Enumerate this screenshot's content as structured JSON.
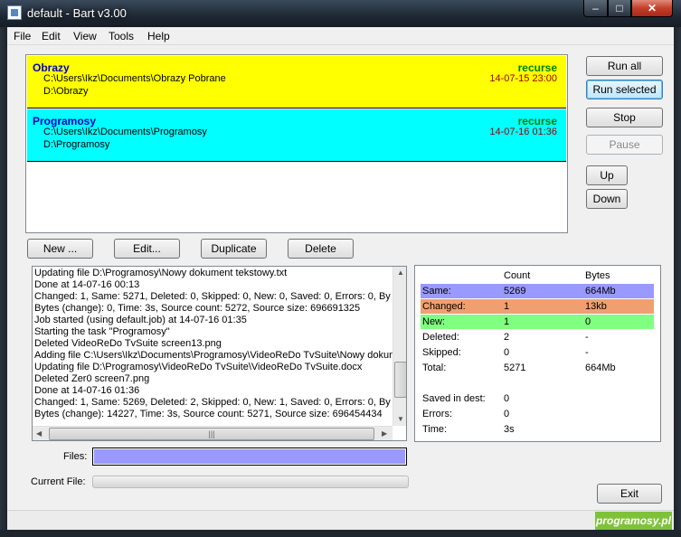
{
  "window": {
    "title": "default - Bart v3.00",
    "minimize": "–",
    "maximize": "□",
    "close": "✕"
  },
  "menu": [
    "File",
    "Edit",
    "View",
    "Tools",
    "Help"
  ],
  "jobs": [
    {
      "name": "Obrazy",
      "mode": "recurse",
      "source": "C:\\Users\\Ikz\\Documents\\Obrazy Pobrane",
      "dest": "D:\\Obrazy",
      "date": "14-07-15 23:00",
      "color": "#ffff00"
    },
    {
      "name": "Programosy",
      "mode": "recurse",
      "source": "C:\\Users\\Ikz\\Documents\\Programosy",
      "dest": "D:\\Programosy",
      "date": "14-07-16 01:36",
      "color": "#00ffff"
    }
  ],
  "side_buttons": {
    "run_all": "Run all",
    "run_selected": "Run selected",
    "stop": "Stop",
    "pause": "Pause",
    "up": "Up",
    "down": "Down"
  },
  "job_buttons": {
    "new": "New ...",
    "edit": "Edit...",
    "duplicate": "Duplicate",
    "delete": "Delete"
  },
  "log": [
    "Updating file D:\\Programosy\\Nowy dokument tekstowy.txt",
    "Done at 14-07-16 00:13",
    "Changed: 1, Same: 5271, Deleted: 0, Skipped: 0, New: 0, Saved: 0, Errors: 0, By",
    "Bytes (change): 0, Time: 3s, Source count: 5272, Source size: 696691325",
    "Job started (using default.job) at 14-07-16 01:35",
    "Starting the task \"Programosy\"",
    "Deleted VideoReDo TvSuite screen13.png",
    "Adding file C:\\Users\\Ikz\\Documents\\Programosy\\VideoReDo TvSuite\\Nowy dokume",
    "Updating file D:\\Programosy\\VideoReDo TvSuite\\VideoReDo TvSuite.docx",
    "Deleted Zer0 screen7.png",
    "Done at 14-07-16 01:36",
    "Changed: 1, Same: 5269, Deleted: 2, Skipped: 0, New: 1, Saved: 0, Errors: 0, By",
    "Bytes (change): 14227, Time: 3s, Source count: 5271, Source size: 696454434"
  ],
  "stats": {
    "header": {
      "count": "Count",
      "bytes": "Bytes"
    },
    "rows": [
      {
        "label": "Same:",
        "count": "5269",
        "bytes": "664Mb",
        "color": "#9999ff"
      },
      {
        "label": "Changed:",
        "count": "1",
        "bytes": "13kb",
        "color": "#f0a070"
      },
      {
        "label": "New:",
        "count": "1",
        "bytes": "0",
        "color": "#80ff80"
      },
      {
        "label": "Deleted:",
        "count": "2",
        "bytes": "-",
        "color": ""
      },
      {
        "label": "Skipped:",
        "count": "0",
        "bytes": "-",
        "color": ""
      },
      {
        "label": "Total:",
        "count": "5271",
        "bytes": "664Mb",
        "color": ""
      }
    ],
    "saved_in_dest": {
      "label": "Saved in dest:",
      "value": "0"
    },
    "errors": {
      "label": "Errors:",
      "value": "0"
    },
    "time": {
      "label": "Time:",
      "value": "3s"
    }
  },
  "progress": {
    "files_label": "Files:",
    "files_fraction": 1.0,
    "files_color": "#9999ff",
    "current_label": "Current File:",
    "current_fraction": 0.0
  },
  "exit_label": "Exit",
  "watermark": "programosy.pl"
}
